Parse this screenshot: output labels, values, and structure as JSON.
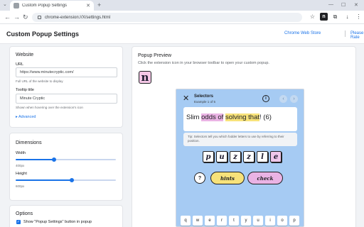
{
  "browser": {
    "tab_title": "Custom Popup Settings",
    "url": "chrome-extension://X/settings.html"
  },
  "header": {
    "title": "Custom Popup Settings",
    "links": [
      "Chrome Web Store",
      "Please Rate"
    ]
  },
  "website": {
    "title": "Website",
    "url_label": "URL",
    "url_value": "https://www.minutecryptic.com/",
    "url_hint": "Full URL of the website to display",
    "tooltip_label": "Tooltip title",
    "tooltip_value": "Minute Cryptic",
    "tooltip_hint": "Shown when hovering over the extension's icon",
    "advanced_label": "Advanced"
  },
  "dimensions": {
    "title": "Dimensions",
    "width_label": "Width",
    "width_value": "400px",
    "width_fraction": 0.38,
    "height_label": "Height",
    "height_value": "600px",
    "height_fraction": 0.56
  },
  "options": {
    "title": "Options",
    "checkbox_label": "Show \"Popup Settings\" button in popup",
    "checked": true
  },
  "preview": {
    "title": "Popup Preview",
    "description": "Click the extension icon in your browser toolbar to open your custom popup.",
    "logo_letter": "n"
  },
  "popup": {
    "close_symbol": "✕",
    "title": "Selectors",
    "subtitle": "Example 1 of 5",
    "info_symbol": "i",
    "prev_symbol": "‹",
    "next_symbol": "›",
    "clue_parts": [
      "Slim ",
      "odds of",
      " ",
      "solving that",
      "! (6)"
    ],
    "tip": "Tip: Selectors tell you which fodder letters to use by referring to their position.",
    "tiles": [
      "p",
      "u",
      "z",
      "z",
      "l",
      "e"
    ],
    "help_symbol": "?",
    "hints_label": "hints",
    "check_label": "check",
    "keyboard_row": [
      "q",
      "w",
      "e",
      "r",
      "t",
      "y",
      "u",
      "i",
      "o",
      "p"
    ]
  },
  "colors": {
    "accent": "#1a73e8",
    "popup_bg": "#a6cbf3",
    "pink": "#eab3e4",
    "yellow": "#f7e27a"
  }
}
